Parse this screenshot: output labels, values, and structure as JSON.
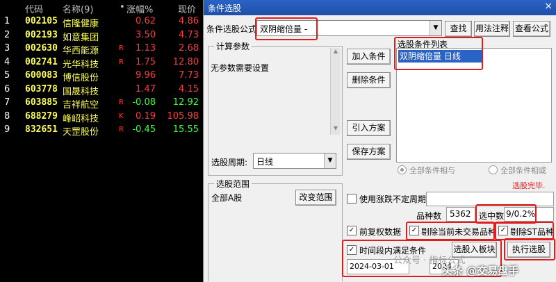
{
  "stock_list": {
    "headers": [
      "代码",
      "名称(9)",
      "•",
      "涨幅%",
      "现价"
    ],
    "rows": [
      {
        "idx": "1",
        "code": "002105",
        "name": "信隆健康",
        "flag": "",
        "chg": "0.62",
        "price": "4.86"
      },
      {
        "idx": "2",
        "code": "002193",
        "name": "如意集团",
        "flag": "",
        "chg": "3.50",
        "price": "4.73"
      },
      {
        "idx": "3",
        "code": "002630",
        "name": "华西能源",
        "flag": "R",
        "chg": "1.13",
        "price": "2.68"
      },
      {
        "idx": "4",
        "code": "002741",
        "name": "光华科技",
        "flag": "R",
        "chg": "1.75",
        "price": "12.80"
      },
      {
        "idx": "5",
        "code": "600083",
        "name": "博信股份",
        "flag": "",
        "chg": "9.96",
        "price": "7.73"
      },
      {
        "idx": "6",
        "code": "603778",
        "name": "国晟科技",
        "flag": "",
        "chg": "1.47",
        "price": "4.15"
      },
      {
        "idx": "7",
        "code": "603885",
        "name": "吉祥航空",
        "flag": "R",
        "chg": "-0.08",
        "price": "12.92"
      },
      {
        "idx": "8",
        "code": "688279",
        "name": "峰岹科技",
        "flag": "K",
        "chg": "0.19",
        "price": "105.98"
      },
      {
        "idx": "9",
        "code": "832651",
        "name": "天罡股份",
        "flag": "R",
        "chg": "-0.45",
        "price": "15.55"
      }
    ],
    "colors": {
      "up": "#ff3c3c",
      "down": "#3cff3c"
    }
  },
  "dialog": {
    "title": "条件选股",
    "close": "×",
    "formula_label": "条件选股公式",
    "formula_value": "双阴缩倍量  -",
    "buttons": {
      "find": "查找",
      "usage": "用法注释",
      "view": "查看公式",
      "add": "加入条件",
      "delete": "删除条件",
      "import": "引入方案",
      "save": "保存方案",
      "change_range": "改变范围",
      "select_to_board": "选股入板块",
      "execute": "执行选股"
    },
    "params_group": "计算参数",
    "no_params": "无参数需要设置",
    "cond_list_label": "选股条件列表",
    "cond_items": [
      "双阴缩倍量  日线"
    ],
    "period_label": "选股周期:",
    "period_value": "日线",
    "radio_and": "全部条件相与",
    "radio_or": "全部条件相或",
    "status": "选股完毕.",
    "range_group": "选股范围",
    "range_value": "全部A股",
    "unfixed_period": "使用涨跌不定周期",
    "count_label": "品种数",
    "count_value": "5362",
    "selected_label": "选中数",
    "selected_value": "9/0.2%",
    "fq": "前复权数据",
    "exclude_untraded": "剔除当前未交易品种",
    "exclude_st": "剔除ST品种",
    "time_range": "时间段内满足条件",
    "date_start": "2024-03-01",
    "date_end": "2024",
    "watermark1": "公众号 · 指标公式",
    "watermark2": "头条 @交易盘手"
  }
}
